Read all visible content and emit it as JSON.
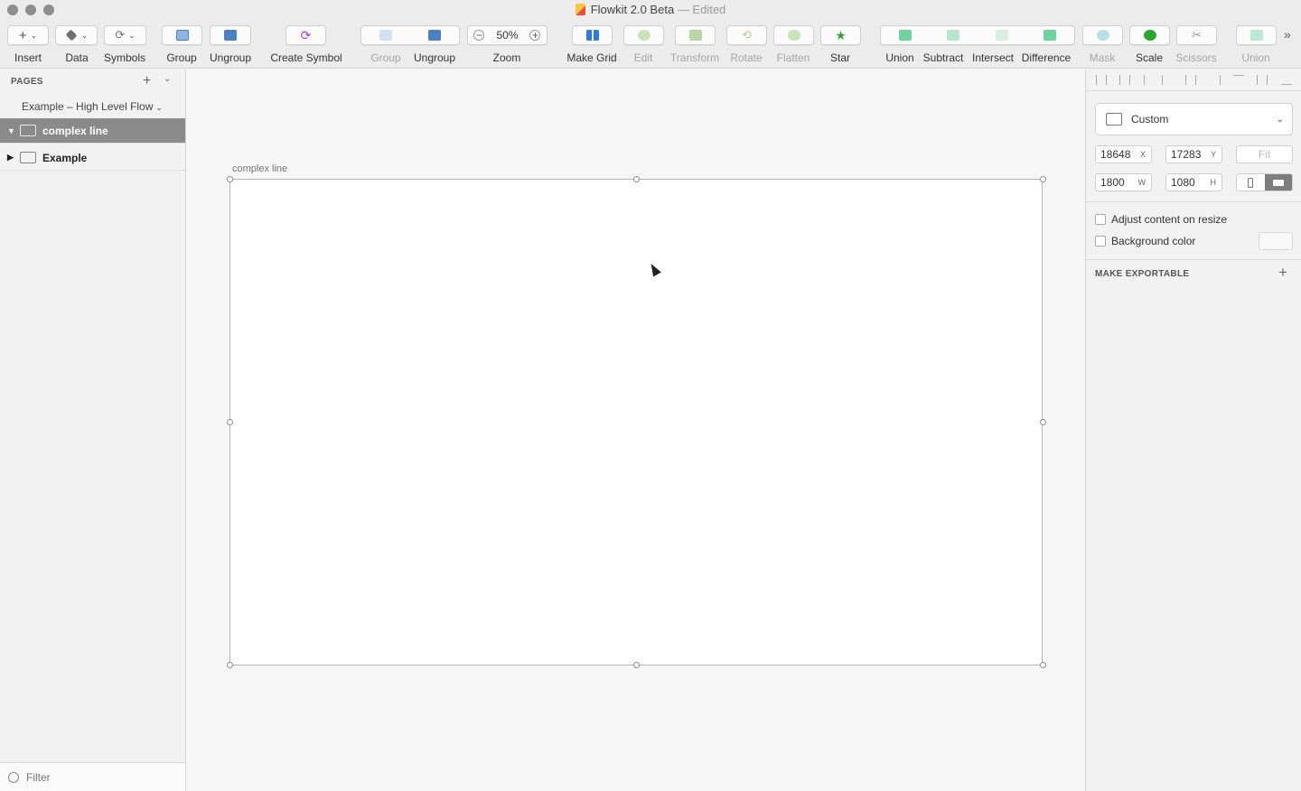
{
  "window": {
    "doc_name": "Flowkit 2.0 Beta",
    "doc_status": "— Edited"
  },
  "toolbar": {
    "insert": "Insert",
    "data": "Data",
    "symbols": "Symbols",
    "group": "Group",
    "ungroup": "Ungroup",
    "create_symbol": "Create Symbol",
    "group2": "Group",
    "ungroup2": "Ungroup",
    "zoom_label": "Zoom",
    "zoom_value": "50%",
    "make_grid": "Make Grid",
    "edit": "Edit",
    "transform": "Transform",
    "rotate": "Rotate",
    "flatten": "Flatten",
    "star": "Star",
    "union": "Union",
    "subtract": "Subtract",
    "intersect": "Intersect",
    "difference": "Difference",
    "mask": "Mask",
    "scale": "Scale",
    "scissors": "Scissors",
    "union2": "Union"
  },
  "sidebar": {
    "pages_header": "PAGES",
    "current_page": "Example – High Level Flow",
    "layers": [
      {
        "label": "complex line",
        "selected": true
      },
      {
        "label": "Example",
        "selected": false
      }
    ],
    "filter_placeholder": "Filter"
  },
  "canvas": {
    "artboard_label": "complex line"
  },
  "inspector": {
    "preset": "Custom",
    "x": "18648",
    "x_unit": "X",
    "y": "17283",
    "y_unit": "Y",
    "fit": "Fit",
    "w": "1800",
    "w_unit": "W",
    "h": "1080",
    "h_unit": "H",
    "adjust_content": "Adjust content on resize",
    "background_color": "Background color",
    "make_exportable": "MAKE EXPORTABLE"
  }
}
